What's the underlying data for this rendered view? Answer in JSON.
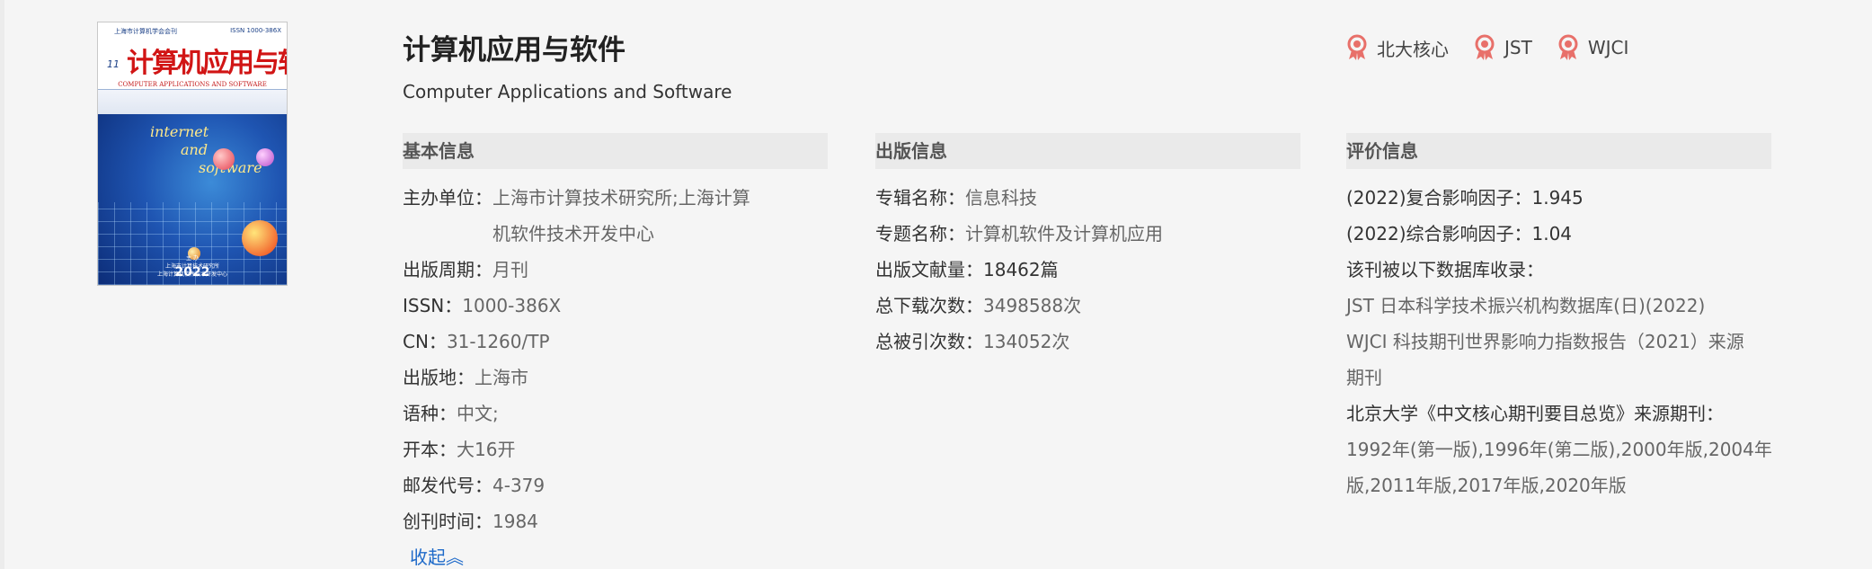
{
  "cover": {
    "publisher_line": "上海市计算机学会会刊",
    "issn_line": "ISSN 1000-386X",
    "issue": "11",
    "title_art": "计算机应用与软件",
    "subtitle_en": "COMPUTER APPLICATIONS AND SOFTWARE",
    "word1": "internet",
    "word2": "and",
    "word3": "software",
    "host_line1": "主 办",
    "host_line2": "上海市计算技术研究所",
    "host_line3": "上海计算机软件技术开发中心",
    "year": "2022"
  },
  "journal": {
    "title": "计算机应用与软件",
    "title_en": "Computer Applications and Software"
  },
  "badges": [
    {
      "label": "北大核心",
      "icon": "award-ribbon-icon"
    },
    {
      "label": "JST",
      "icon": "award-ribbon-icon"
    },
    {
      "label": "WJCI",
      "icon": "award-ribbon-icon"
    }
  ],
  "basic": {
    "heading": "基本信息",
    "sponsor_k": "主办单位：",
    "sponsor_v1": "上海市计算技术研究所;上海计算",
    "sponsor_v2": "机软件技术开发中心",
    "period_k": "出版周期：",
    "period_v": "月刊",
    "issn_k": "ISSN：",
    "issn_v": "1000-386X",
    "cn_k": "CN：",
    "cn_v": "31-1260/TP",
    "place_k": "出版地：",
    "place_v": "上海市",
    "lang_k": "语种：",
    "lang_v": "中文;",
    "format_k": "开本：",
    "format_v": "大16开",
    "postal_k": "邮发代号：",
    "postal_v": "4-379",
    "founded_k": "创刊时间：",
    "founded_v": "1984"
  },
  "publish": {
    "heading": "出版信息",
    "series_k": "专辑名称：",
    "series_v": "信息科技",
    "topic_k": "专题名称：",
    "topic_v": "计算机软件及计算机应用",
    "docs_k": "出版文献量：",
    "docs_v": "18462篇",
    "downloads_k": "总下载次数：",
    "downloads_v": "3498588次",
    "cites_k": "总被引次数：",
    "cites_v": "134052次"
  },
  "evaluation": {
    "heading": "评价信息",
    "if_composite": "(2022)复合影响因子：1.945",
    "if_comprehensive": "(2022)综合影响因子：1.04",
    "indexed_label": "该刊被以下数据库收录：",
    "db1": "JST 日本科学技术振兴机构数据库(日)(2022)",
    "db2_line1": "WJCI 科技期刊世界影响力指数报告（2021）来源",
    "db2_line2": "期刊",
    "pku_label": "北京大学《中文核心期刊要目总览》来源期刊：",
    "pku_line1": "1992年(第一版),1996年(第二版),2000年版,2004年",
    "pku_line2": "版,2011年版,2017年版,2020年版"
  },
  "collapse_label": "收起︽"
}
